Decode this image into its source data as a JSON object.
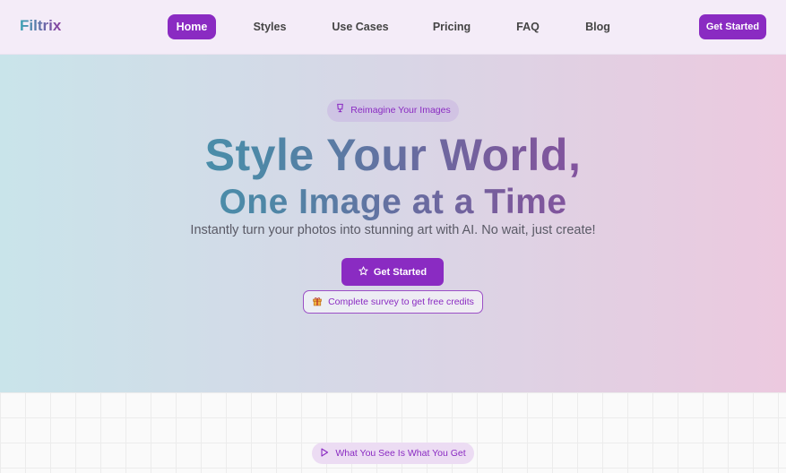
{
  "brand": {
    "logo_text": "Filtrix"
  },
  "nav": {
    "items": [
      {
        "label": "Home",
        "active": true
      },
      {
        "label": "Styles",
        "active": false
      },
      {
        "label": "Use Cases",
        "active": false
      },
      {
        "label": "Pricing",
        "active": false
      },
      {
        "label": "FAQ",
        "active": false
      },
      {
        "label": "Blog",
        "active": false
      }
    ],
    "cta_label": "Get Started"
  },
  "hero": {
    "badge_label": "Reimagine Your Images",
    "badge_icon": "glass-icon",
    "title_line1": "Style Your World,",
    "title_line2": "One Image at a Time",
    "subtitle": "Instantly turn your photos into stunning art with AI. No wait, just create!",
    "cta_label": "Get Started",
    "cta_icon": "star-icon",
    "survey_label": "Complete survey to get free credits",
    "survey_icon": "gift-icon"
  },
  "section": {
    "badge_label": "What You See Is What You Get",
    "badge_icon": "play-icon"
  },
  "colors": {
    "accent": "#8a2bc2",
    "gradient_start": "#3aa3b4",
    "gradient_end": "#9a3fa3"
  }
}
